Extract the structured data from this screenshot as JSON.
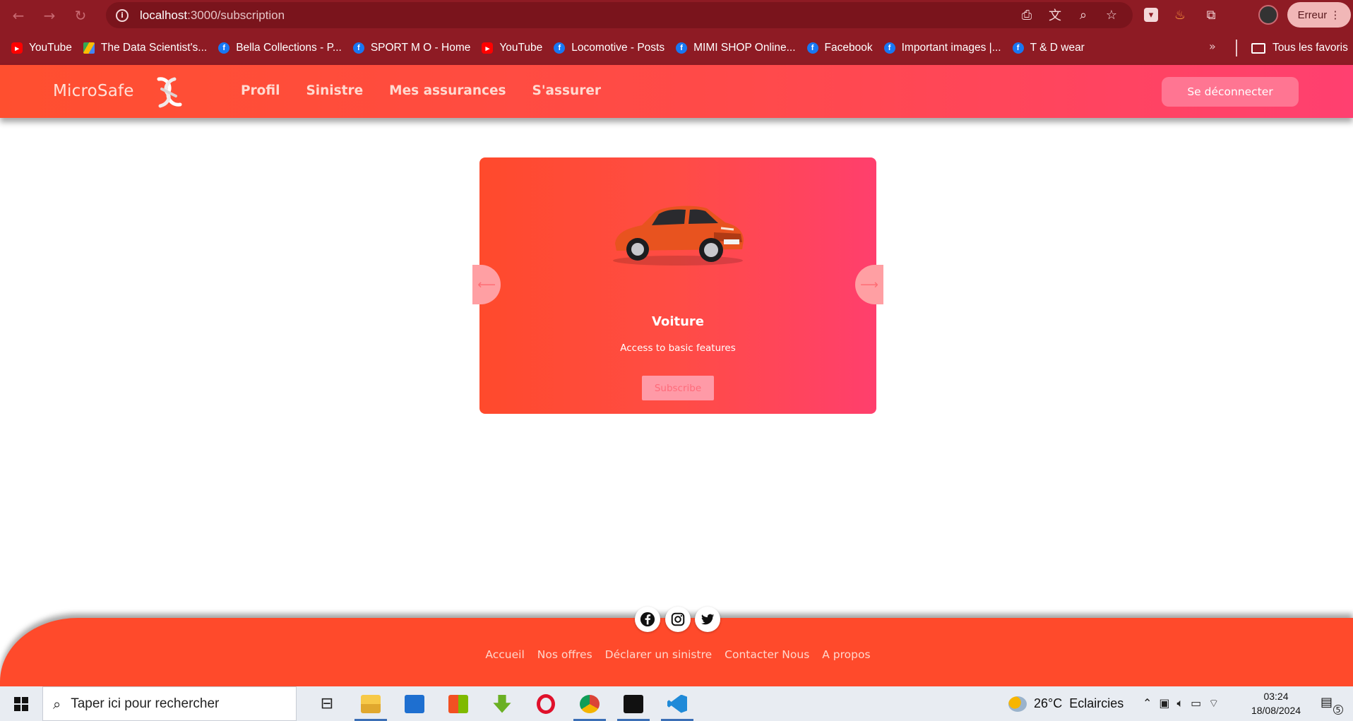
{
  "browser": {
    "url_host": "localhost",
    "url_rest": ":3000/subscription",
    "profile_button": "Erreur"
  },
  "bookmarks": [
    {
      "label": "YouTube",
      "icon": "youtube-icon"
    },
    {
      "label": "The Data Scientist's...",
      "icon": "drive-icon"
    },
    {
      "label": "Bella Collections - P...",
      "icon": "facebook-icon"
    },
    {
      "label": "SPORT M O - Home",
      "icon": "facebook-icon"
    },
    {
      "label": "YouTube",
      "icon": "youtube-icon"
    },
    {
      "label": "Locomotive - Posts",
      "icon": "facebook-icon"
    },
    {
      "label": "MIMI SHOP Online...",
      "icon": "facebook-icon"
    },
    {
      "label": "Facebook",
      "icon": "facebook-icon"
    },
    {
      "label": "Important images |...",
      "icon": "facebook-icon"
    },
    {
      "label": "T & D wear",
      "icon": "facebook-icon"
    }
  ],
  "bookmarks_all": "Tous les favoris",
  "app": {
    "brand": "MicroSafe",
    "nav": [
      "Profil",
      "Sinistre",
      "Mes assurances",
      "S'assurer"
    ],
    "logout": "Se déconnecter"
  },
  "card": {
    "title": "Voiture",
    "description": "Access to basic features",
    "button": "Subscribe"
  },
  "footer": {
    "links": [
      "Accueil",
      "Nos offres",
      "Déclarer un sinistre",
      "Contacter Nous",
      "A propos"
    ]
  },
  "taskbar": {
    "search_placeholder": "Taper ici pour rechercher",
    "temperature": "26°C",
    "weather": "Eclaircies",
    "time": "03:24",
    "date": "18/08/2024",
    "notifications": "5"
  },
  "colors": {
    "chrome": "#8e1b24",
    "brand_accent": "#ff4a2c",
    "brand_pink": "#ff3f6d"
  }
}
